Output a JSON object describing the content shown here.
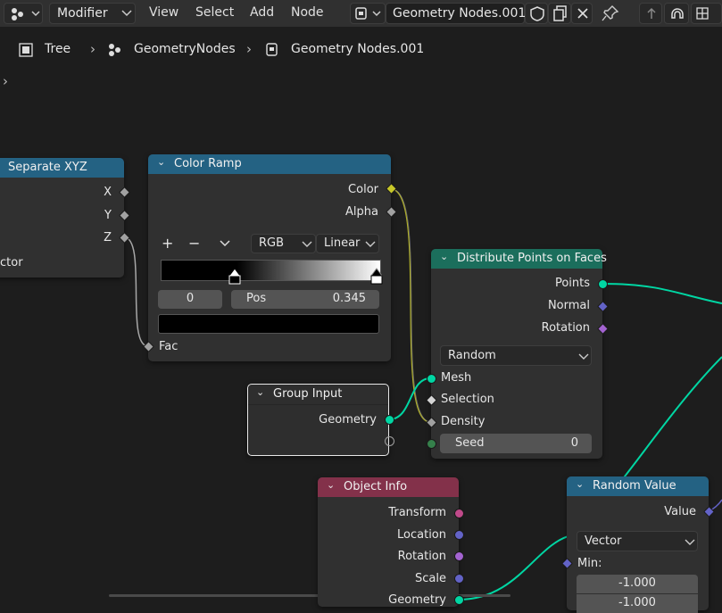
{
  "header": {
    "editor_type_icon": "node-editor-icon",
    "mode_label": "Modifier",
    "menus": [
      "View",
      "Select",
      "Add",
      "Node"
    ],
    "node_tree_name": "Geometry Nodes.001"
  },
  "breadcrumb": {
    "items": [
      "Tree",
      "GeometryNodes",
      "Geometry Nodes.001"
    ]
  },
  "nodes": {
    "separate_xyz": {
      "title": "Separate XYZ",
      "outputs": [
        "X",
        "Y",
        "Z"
      ],
      "input_partial": "ector"
    },
    "color_ramp": {
      "title": "Color Ramp",
      "outputs": [
        "Color",
        "Alpha"
      ],
      "add_label": "+",
      "remove_label": "−",
      "color_mode": "RGB",
      "interpolation": "Linear",
      "stop_index": "0",
      "pos_label": "Pos",
      "pos_value": "0.345",
      "input": "Fac"
    },
    "distribute_points": {
      "title": "Distribute Points on Faces",
      "outputs": [
        "Points",
        "Normal",
        "Rotation"
      ],
      "distribute_method": "Random",
      "inputs": [
        "Mesh",
        "Selection",
        "Density"
      ],
      "seed_label": "Seed",
      "seed_value": "0"
    },
    "group_input": {
      "title": "Group Input",
      "output": "Geometry"
    },
    "object_info": {
      "title": "Object Info",
      "outputs": [
        "Transform",
        "Location",
        "Rotation",
        "Scale",
        "Geometry"
      ]
    },
    "random_value": {
      "title": "Random Value",
      "output": "Value",
      "data_type": "Vector",
      "min_label": "Min:",
      "min_x": "-1.000",
      "min_y": "-1.000"
    }
  },
  "colors": {
    "background": "#1d1d1d",
    "converter_header": "#246283",
    "geometry_header": "#1b6e5c",
    "input_header": "#83314a",
    "geometry_socket": "#00d6a3",
    "vector_socket": "#6363c7",
    "rotation_socket": "#a363d0",
    "float_socket": "#a1a1a1",
    "color_socket": "#c7c729",
    "int_socket": "#35804b",
    "annotation_arrow": "#e01010"
  }
}
